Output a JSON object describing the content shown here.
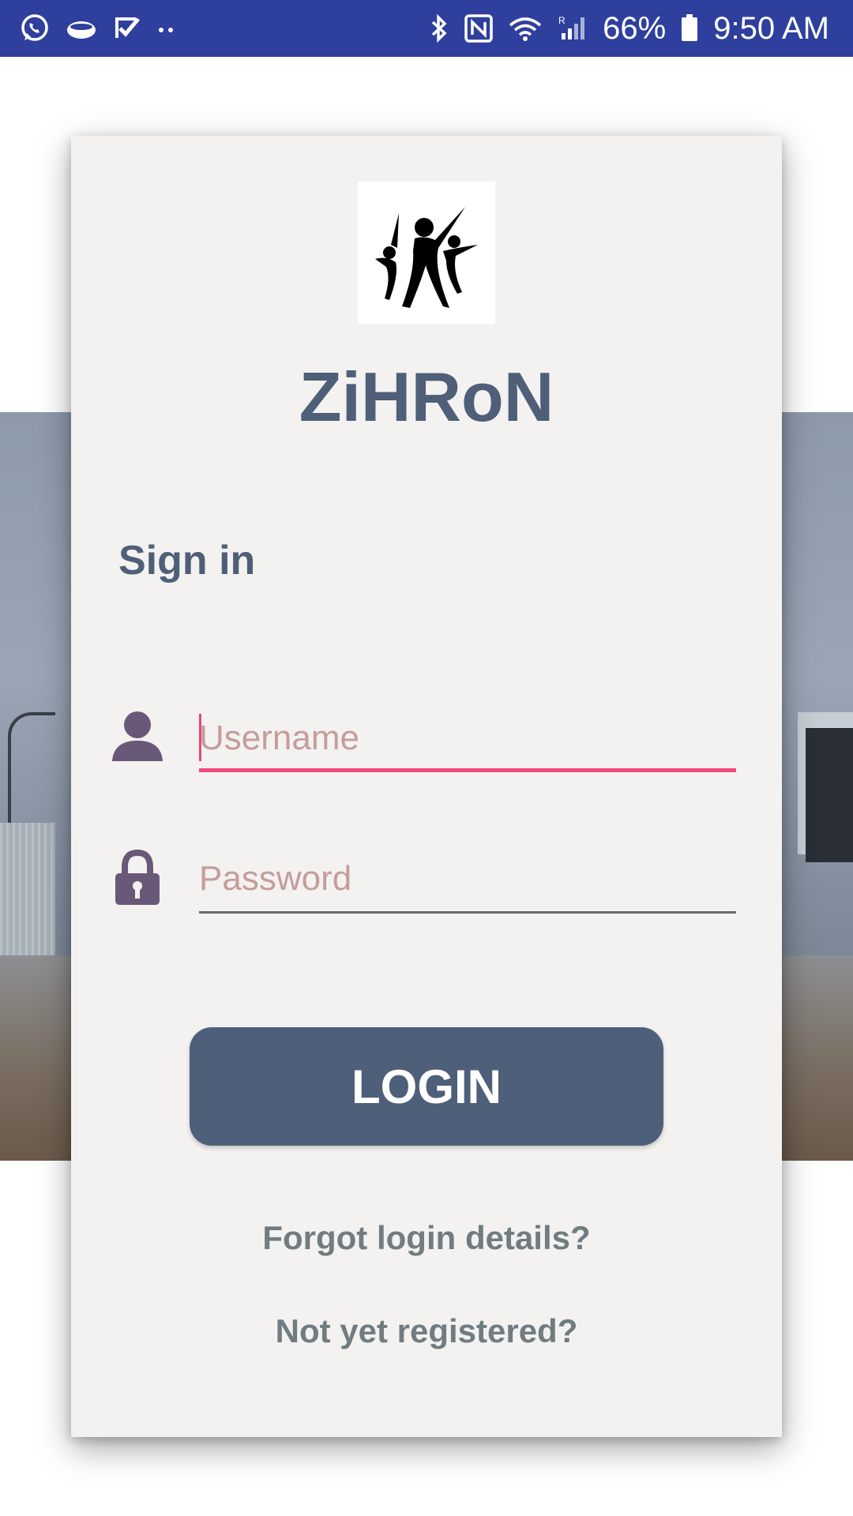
{
  "status_bar": {
    "left_icons": [
      "whatsapp-icon",
      "cloud-icon",
      "checkmark-icon",
      "more-dots-icon"
    ],
    "right_icons": [
      "bluetooth-icon",
      "nfc-icon",
      "wifi-icon",
      "signal-icon",
      "battery-icon"
    ],
    "battery": "66%",
    "time": "9:50 AM",
    "bg_color": "#2f3f9e"
  },
  "card": {
    "logo_icon": "people-logo-icon",
    "app_name": "ZiHRoN",
    "heading": "Sign in",
    "username": {
      "icon": "user-icon",
      "placeholder": "Username",
      "value": ""
    },
    "password": {
      "icon": "lock-icon",
      "placeholder": "Password",
      "value": ""
    },
    "login_label": "LOGIN",
    "forgot_label": "Forgot login details?",
    "register_label": "Not yet registered?"
  },
  "colors": {
    "primary": "#4e5f7a",
    "accent": "#f04a7c",
    "placeholder": "#c59d9a",
    "icon": "#6a5878"
  }
}
